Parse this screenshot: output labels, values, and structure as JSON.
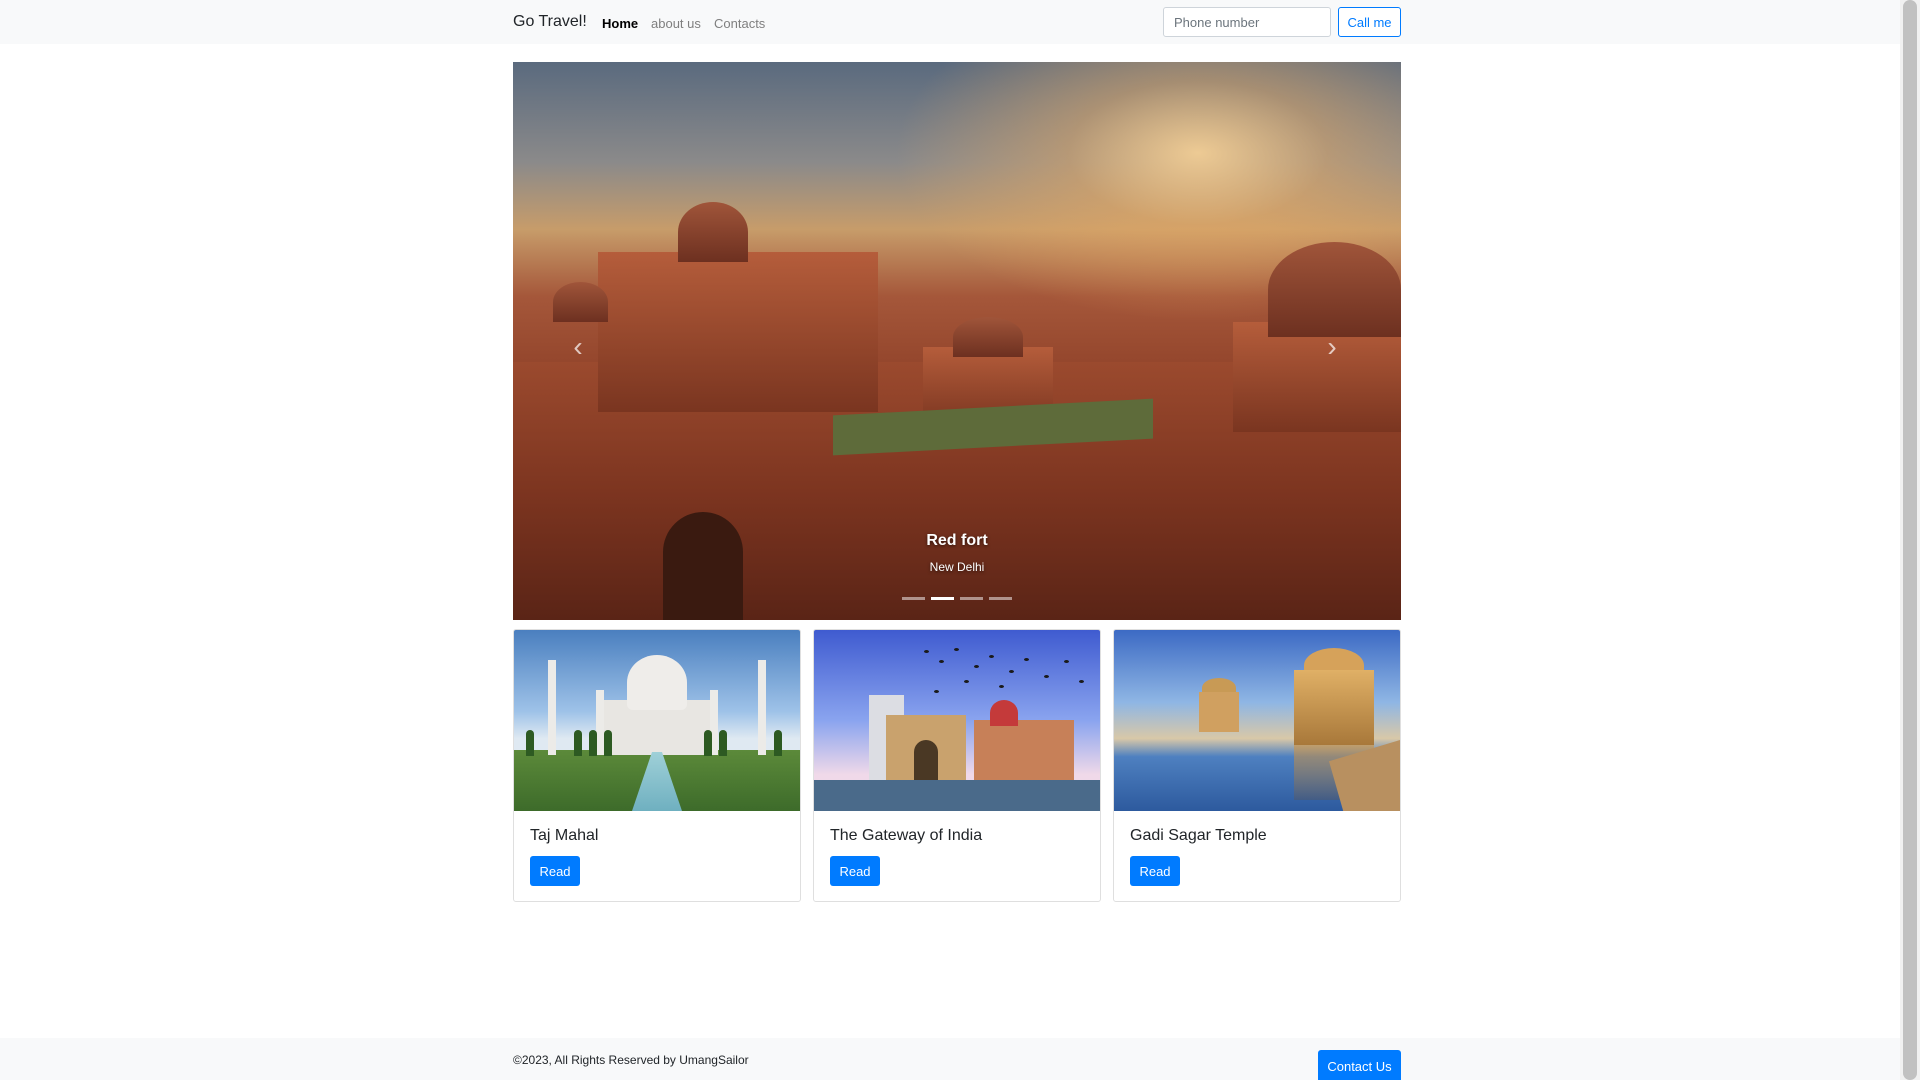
{
  "navbar": {
    "brand": "Go Travel!",
    "links": [
      {
        "label": "Home",
        "active": true
      },
      {
        "label": "about us",
        "active": false
      },
      {
        "label": "Contacts",
        "active": false
      }
    ],
    "phone_placeholder": "Phone number",
    "phone_value": "",
    "call_label": "Call me"
  },
  "carousel": {
    "slide_title": "Red fort",
    "slide_subtitle": "New Delhi",
    "prev_icon": "chevron-left-icon",
    "next_icon": "chevron-right-icon",
    "indicator_count": 4,
    "active_indicator": 1
  },
  "cards": [
    {
      "title": "Taj Mahal",
      "button": "Read"
    },
    {
      "title": "The Gateway of India",
      "button": "Read"
    },
    {
      "title": "Gadi Sagar Temple",
      "button": "Read"
    }
  ],
  "footer": {
    "copyright": "©2023, All Rights Reserved by UmangSailor",
    "contact_label": "Contact Us"
  },
  "colors": {
    "primary": "#007bff",
    "navbar_bg": "#f8f9fa",
    "text": "#212529",
    "muted": "#7f7f7f"
  }
}
